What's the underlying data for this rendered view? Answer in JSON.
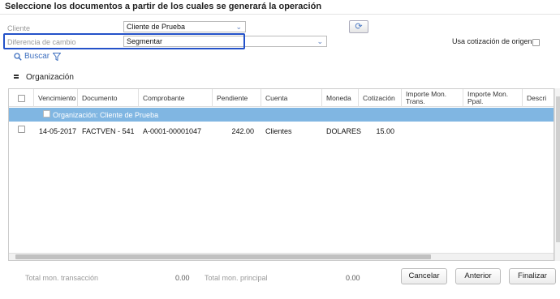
{
  "dialog": {
    "title": "Seleccione los documentos a partir de los cuales se generará la operación"
  },
  "form": {
    "cliente_label": "Cliente",
    "cliente_value": "Cliente de Prueba",
    "diferencia_label": "Diferencia de cambio",
    "diferencia_value": "Segmentar",
    "usa_cotizacion_label": "Usa cotización de origen",
    "buscar_label": "Buscar"
  },
  "grouping": {
    "label": "Organización"
  },
  "table": {
    "columns": [
      "Vencimiento",
      "Documento",
      "Comprobante",
      "Pendiente",
      "Cuenta",
      "Moneda",
      "Cotización",
      "Importe Mon. Trans.",
      "Importe Mon. Ppal.",
      "Descri"
    ],
    "group_label": "Organización: Cliente de Prueba",
    "rows": [
      {
        "vencimiento": "14-05-2017",
        "documento": "FACTVEN - 541",
        "comprobante": "A-0001-00001047",
        "pendiente": "242.00",
        "cuenta": "Clientes",
        "moneda": "DOLARES",
        "cotizacion": "15.00",
        "importe_trans": "",
        "importe_ppal": ""
      }
    ]
  },
  "footer": {
    "total_trans_label": "Total mon. transacción",
    "total_trans_value": "0.00",
    "total_ppal_label": "Total mon. principal",
    "total_ppal_value": "0.00",
    "cancelar": "Cancelar",
    "anterior": "Anterior",
    "finalizar": "Finalizar"
  },
  "colors": {
    "accent": "#3d6fbf",
    "group_row": "#80b6e2",
    "highlight_border": "#2452c9"
  },
  "icons": {
    "refresh": "refresh-icon",
    "search": "search-icon",
    "filter": "filter-icon",
    "grid": "grid-icon",
    "dropdown": "chevron-down-icon"
  }
}
